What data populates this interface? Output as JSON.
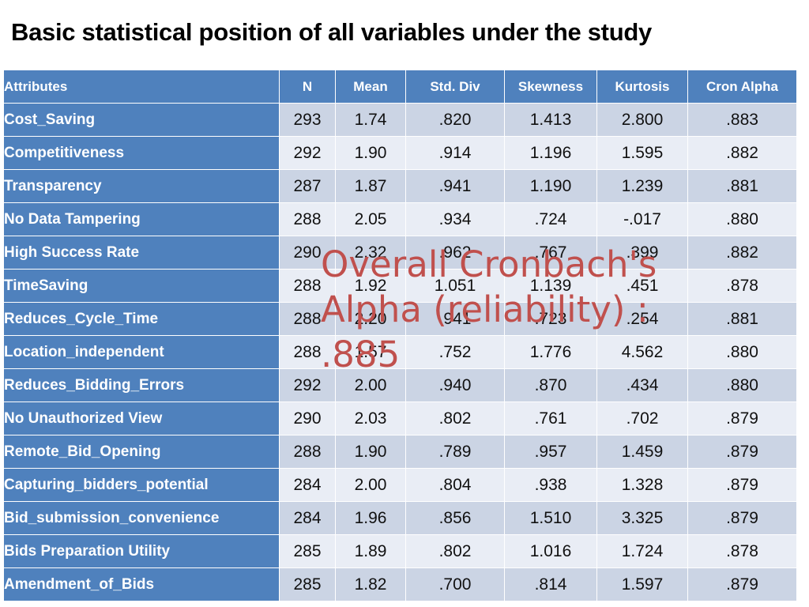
{
  "slide": {
    "title": "Basic statistical position of all variables under the study"
  },
  "overlay": {
    "note": "Overall Cronbach's Alpha (reliability) : .885"
  },
  "table": {
    "headers": {
      "attributes": "Attributes",
      "n": "N",
      "mean": "Mean",
      "std_div": "Std. Div",
      "skewness": "Skewness",
      "kurtosis": "Kurtosis",
      "cron_alpha": "Cron Alpha"
    },
    "rows": [
      {
        "attribute": "Cost_Saving",
        "n": "293",
        "mean": "1.74",
        "std_div": ".820",
        "skewness": "1.413",
        "kurtosis": "2.800",
        "cron_alpha": ".883"
      },
      {
        "attribute": "Competitiveness",
        "n": "292",
        "mean": "1.90",
        "std_div": ".914",
        "skewness": "1.196",
        "kurtosis": "1.595",
        "cron_alpha": ".882"
      },
      {
        "attribute": "Transparency",
        "n": "287",
        "mean": "1.87",
        "std_div": ".941",
        "skewness": "1.190",
        "kurtosis": "1.239",
        "cron_alpha": ".881"
      },
      {
        "attribute": "No Data Tampering",
        "n": "288",
        "mean": "2.05",
        "std_div": ".934",
        "skewness": ".724",
        "kurtosis": "-.017",
        "cron_alpha": ".880"
      },
      {
        "attribute": "High Success Rate",
        "n": "290",
        "mean": "2.32",
        "std_div": ".962",
        "skewness": ".767",
        "kurtosis": ".399",
        "cron_alpha": ".882"
      },
      {
        "attribute": "TimeSaving",
        "n": "288",
        "mean": "1.92",
        "std_div": "1.051",
        "skewness": "1.139",
        "kurtosis": ".451",
        "cron_alpha": ".878"
      },
      {
        "attribute": "Reduces_Cycle_Time",
        "n": "288",
        "mean": "2.20",
        "std_div": ".941",
        "skewness": ".723",
        "kurtosis": ".254",
        "cron_alpha": ".881"
      },
      {
        "attribute": "Location_independent",
        "n": "288",
        "mean": "1.57",
        "std_div": ".752",
        "skewness": "1.776",
        "kurtosis": "4.562",
        "cron_alpha": ".880"
      },
      {
        "attribute": "Reduces_Bidding_Errors",
        "n": "292",
        "mean": "2.00",
        "std_div": ".940",
        "skewness": ".870",
        "kurtosis": ".434",
        "cron_alpha": ".880"
      },
      {
        "attribute": "No Unauthorized View",
        "n": "290",
        "mean": "2.03",
        "std_div": ".802",
        "skewness": ".761",
        "kurtosis": ".702",
        "cron_alpha": ".879"
      },
      {
        "attribute": "Remote_Bid_Opening",
        "n": "288",
        "mean": "1.90",
        "std_div": ".789",
        "skewness": ".957",
        "kurtosis": "1.459",
        "cron_alpha": ".879"
      },
      {
        "attribute": "Capturing_bidders_potential",
        "n": "284",
        "mean": "2.00",
        "std_div": ".804",
        "skewness": ".938",
        "kurtosis": "1.328",
        "cron_alpha": ".879"
      },
      {
        "attribute": "Bid_submission_convenience",
        "n": "284",
        "mean": "1.96",
        "std_div": ".856",
        "skewness": "1.510",
        "kurtosis": "3.325",
        "cron_alpha": ".879"
      },
      {
        "attribute": "Bids Preparation Utility",
        "n": "285",
        "mean": "1.89",
        "std_div": ".802",
        "skewness": "1.016",
        "kurtosis": "1.724",
        "cron_alpha": ".878"
      },
      {
        "attribute": "Amendment_of_Bids",
        "n": "285",
        "mean": "1.82",
        "std_div": ".700",
        "skewness": ".814",
        "kurtosis": "1.597",
        "cron_alpha": ".879"
      }
    ]
  },
  "colors": {
    "header_blue": "#4F81BD",
    "band_dark": "#CBD4E4",
    "band_light": "#E9EDF5",
    "overlay_red": "#C0504D",
    "title_black": "#000000"
  }
}
